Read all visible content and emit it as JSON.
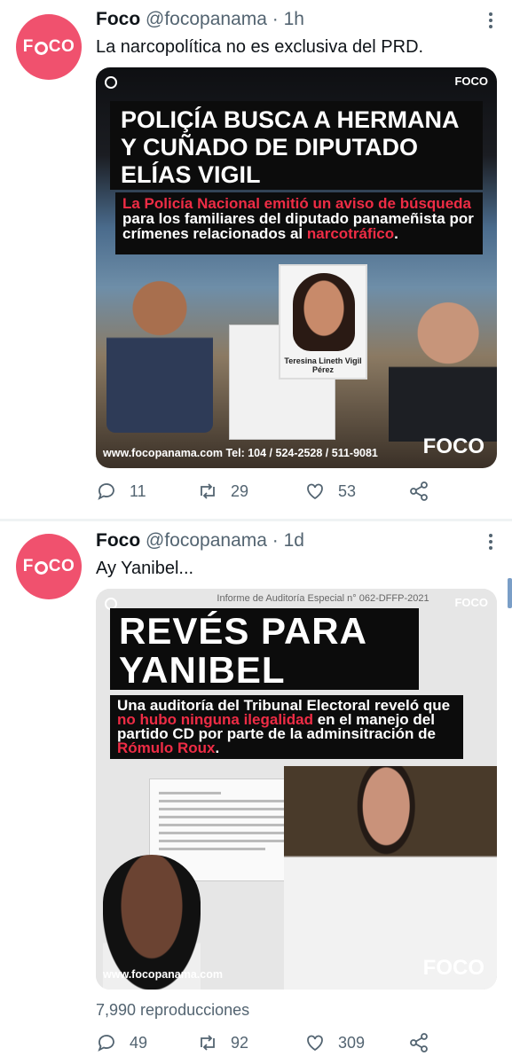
{
  "tweets": [
    {
      "author_name": "Foco",
      "handle": "@focopanama",
      "time": "· 1h",
      "text": "La narcopolítica no es exclusiva del PRD.",
      "media": {
        "logo": "FOCO",
        "headline": "POLIÇÍA BUSCA A HERMANA Y CUÑADO DE DIPUTADO ELÍAS VIGIL",
        "subtitle_parts": [
          "La Policía Nacional emitió un aviso de búsqueda",
          " para los familiares del diputado panameñista por crímenes relacionados al ",
          "narcotráfico",
          "."
        ],
        "photo_caption": "Teresina Lineth Vigil Pérez",
        "footer": "www.focopanama.com Tel: 104 / 524-2528 / 511-9081",
        "watermark": "FOCO"
      },
      "actions": {
        "replies": "11",
        "retweets": "29",
        "likes": "53"
      }
    },
    {
      "author_name": "Foco",
      "handle": "@focopanama",
      "time": "· 1d",
      "text": "Ay Yanibel...",
      "media": {
        "logo": "FOCO",
        "headline": "REVÉS PARA YANIBEL",
        "subtitle_parts": [
          "Una auditoría del Tribunal Electoral reveló que ",
          "no hubo ninguna ilegalidad",
          " en el manejo del partido CD por parte de la adminsitración de ",
          "Rómulo Roux",
          "."
        ],
        "document_title": "Informe de Auditoría Especial n° 062-DFFP-2021",
        "footer": "www.focopanama.com",
        "watermark": "FOCO"
      },
      "views": "7,990 reproducciones",
      "actions": {
        "replies": "49",
        "retweets": "92",
        "likes": "309"
      }
    }
  ],
  "colors": {
    "accent_red": "#ee2c45",
    "avatar": "#f0516e",
    "muted": "#536471"
  },
  "icons": [
    "more-icon",
    "reply-icon",
    "retweet-icon",
    "like-icon",
    "share-icon"
  ]
}
